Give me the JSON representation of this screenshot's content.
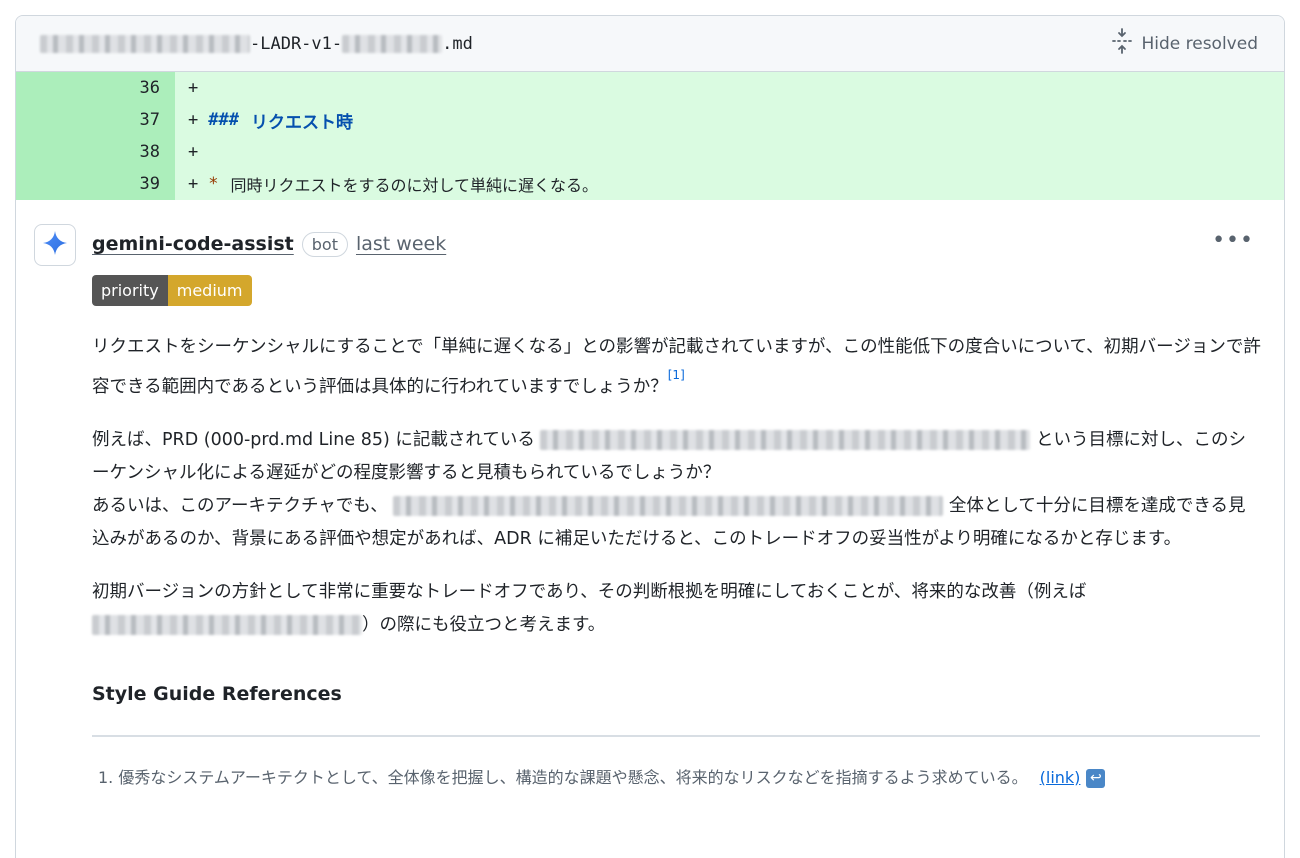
{
  "file": {
    "path_middle": "-LADR-v1-",
    "path_ext": ".md",
    "hide_resolved_label": "Hide resolved"
  },
  "diff": {
    "lines": [
      {
        "num": "36",
        "plus": "+",
        "text": ""
      },
      {
        "num": "37",
        "plus": "+",
        "hash": "###",
        "heading": "リクエスト時"
      },
      {
        "num": "38",
        "plus": "+",
        "text": ""
      },
      {
        "num": "39",
        "plus": "+",
        "bullet": "*",
        "text": "同時リクエストをするのに対して単純に遅くなる。"
      }
    ]
  },
  "comment": {
    "author": "gemini-code-assist",
    "badge": "bot",
    "time": "last week",
    "more_label": "•••",
    "priority_key": "priority",
    "priority_value": "medium",
    "p1": "リクエストをシーケンシャルにすることで「単純に遅くなる」との影響が記載されていますが、この性能低下の度合いについて、初期バージョンで許容できる範囲内であるという評価は具体的に行われていますでしょうか？",
    "p1_footnote": "[1]",
    "p2_a": "例えば、PRD (000-prd.md Line 85) に記載されている",
    "p2_b": "という目標に対し、このシーケンシャル化による遅延がどの程度影響すると見積もられているでしょうか？",
    "p2_c": "あるいは、このアーキテクチャでも、",
    "p2_d": "全体として十分に目標を達成できる見込みがあるのか、背景にある評価や想定があれば、ADR に補足いただけると、このトレードオフの妥当性がより明確になるかと存じます。",
    "p3_a": "初期バージョンの方針として非常に重要なトレードオフであり、その判断根拠を明確にしておくことが、将来的な改善（例えば",
    "p3_b": "）の際にも役立つと考えます。",
    "style_guide_heading": "Style Guide References",
    "ref1_text": "1. 優秀なシステムアーキテクトとして、全体像を把握し、構造的な課題や懸念、将来的なリスクなどを指摘するよう求めている。",
    "ref1_link": "(link)",
    "ref1_backref": "↩"
  },
  "colors": {
    "added_bg": "#dafbe1",
    "added_num_bg": "#aceebb",
    "priority_medium": "#d4a72c",
    "link": "#0969da"
  },
  "icons": [
    "fold-icon",
    "gemini-sparkle-icon",
    "kebab-menu-icon",
    "return-arrow-icon"
  ]
}
